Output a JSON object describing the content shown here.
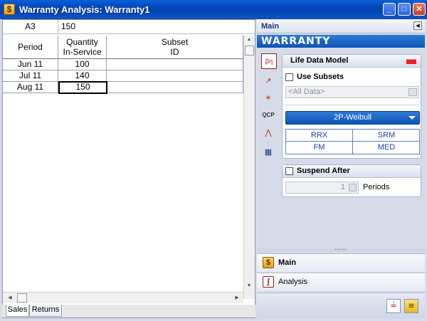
{
  "window": {
    "title": "Warranty Analysis: Warranty1",
    "app_icon_glyph": "$",
    "minimize_glyph": "_",
    "maximize_glyph": "□",
    "close_glyph": "✕"
  },
  "formula_bar": {
    "cell_ref": "A3",
    "value": "150"
  },
  "table": {
    "columns": [
      {
        "line1": "Period",
        "line2": ""
      },
      {
        "line1": "Quantity",
        "line2": "In-Service"
      },
      {
        "line1": "Subset",
        "line2": "ID"
      }
    ],
    "rows": [
      {
        "period": "Jun 11",
        "quantity": "100",
        "subset": ""
      },
      {
        "period": "Jul 11",
        "quantity": "140",
        "subset": ""
      },
      {
        "period": "Aug 11",
        "quantity": "150",
        "subset": ""
      }
    ]
  },
  "scrollbar": {
    "up": "▲",
    "down": "▼",
    "left": "◀",
    "right": "▶"
  },
  "sheet_tabs": [
    {
      "label": "Sales"
    },
    {
      "label": "Returns"
    }
  ],
  "side_panel": {
    "header": "Main",
    "collapse_glyph": "◀",
    "banner": "WARRANTY",
    "tool_icons": [
      {
        "glyph": "βη"
      },
      {
        "glyph": "↗"
      },
      {
        "glyph": "✶"
      },
      {
        "glyph": "QCP"
      },
      {
        "glyph": "⋀"
      },
      {
        "glyph": "▦"
      }
    ],
    "life_data_model": {
      "title": "Life Data Model",
      "use_subsets_label": "Use Subsets",
      "subsets_value": "<All Data>",
      "distribution": "2P-Weibull",
      "methods": [
        "RRX",
        "SRM",
        "FM",
        "MED"
      ]
    },
    "suspend_after": {
      "title": "Suspend After",
      "value": "1",
      "unit_label": "Periods"
    },
    "splitter_glyph": "•••••",
    "nav": [
      {
        "label": "Main",
        "glyph": "$"
      },
      {
        "label": "Analysis",
        "glyph": "∫"
      }
    ],
    "bottom_buttons": [
      {
        "glyph": "≟"
      },
      {
        "glyph": "≋"
      }
    ]
  },
  "colors": {
    "title_bar": "#0346b8",
    "banner": "#0a55b8",
    "distribution_button": "#1765c8",
    "method_text": "#1a3fa8",
    "model_indicator": "#ee2222"
  }
}
